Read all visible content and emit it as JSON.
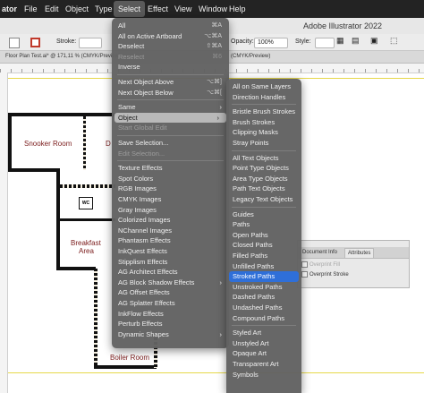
{
  "menubar": {
    "app": "ator",
    "items": [
      "File",
      "Edit",
      "Object",
      "Type",
      "Select",
      "Effect",
      "View",
      "Window",
      "Help"
    ],
    "active": "Select"
  },
  "app_title": "Adobe Illustrator 2022",
  "controlbar": {
    "stroke_label": "Stroke:",
    "opacity_label": "Opacity:",
    "opacity_value": "100%",
    "style_label": "Style:"
  },
  "document_tab": "Floor Plan Test.ai* @ 171,11 % (CMYK/Preview)",
  "document_tab_2": "(CMYK/Preview)",
  "floorplan": {
    "rooms": [
      "Snooker Room",
      "D",
      "WC",
      "Breakfast",
      "Area",
      "Boiler Room"
    ]
  },
  "select_menu": {
    "items": [
      {
        "label": "All",
        "shortcut": "⌘A"
      },
      {
        "label": "All on Active Artboard",
        "shortcut": "⌥⌘A"
      },
      {
        "label": "Deselect",
        "shortcut": "⇧⌘A"
      },
      {
        "label": "Reselect",
        "shortcut": "⌘6",
        "disabled": true
      },
      {
        "label": "Inverse"
      },
      {
        "label": "Next Object Above",
        "shortcut": "⌥⌘]"
      },
      {
        "label": "Next Object Below",
        "shortcut": "⌥⌘["
      },
      {
        "label": "Same",
        "submenu": true
      },
      {
        "label": "Object",
        "submenu": true,
        "highlighted": true
      },
      {
        "label": "Start Global Edit",
        "disabled": true
      },
      {
        "label": "Save Selection..."
      },
      {
        "label": "Edit Selection...",
        "disabled": true
      },
      {
        "label": "Texture Effects"
      },
      {
        "label": "Spot Colors"
      },
      {
        "label": "RGB Images"
      },
      {
        "label": "CMYK Images"
      },
      {
        "label": "Gray Images"
      },
      {
        "label": "Colorized Images"
      },
      {
        "label": "NChannel Images"
      },
      {
        "label": "Phantasm Effects"
      },
      {
        "label": "InkQuest Effects"
      },
      {
        "label": "Stipplism Effects"
      },
      {
        "label": "AG Architect Effects"
      },
      {
        "label": "AG Block Shadow Effects",
        "submenu": true
      },
      {
        "label": "AG Offset Effects"
      },
      {
        "label": "AG Splatter Effects"
      },
      {
        "label": "InkFlow Effects"
      },
      {
        "label": "Perturb Effects"
      },
      {
        "label": "Dynamic Shapes",
        "submenu": true
      }
    ]
  },
  "object_submenu": {
    "items": [
      {
        "label": "All on Same Layers"
      },
      {
        "label": "Direction Handles"
      },
      {
        "label": "Bristle Brush Strokes"
      },
      {
        "label": "Brush Strokes"
      },
      {
        "label": "Clipping Masks"
      },
      {
        "label": "Stray Points"
      },
      {
        "label": "All Text Objects"
      },
      {
        "label": "Point Type Objects"
      },
      {
        "label": "Area Type Objects"
      },
      {
        "label": "Path Text Objects"
      },
      {
        "label": "Legacy Text Objects"
      },
      {
        "label": "Guides"
      },
      {
        "label": "Paths"
      },
      {
        "label": "Open Paths"
      },
      {
        "label": "Closed Paths"
      },
      {
        "label": "Filled Paths"
      },
      {
        "label": "Unfilled Paths"
      },
      {
        "label": "Stroked Paths",
        "selected": true
      },
      {
        "label": "Unstroked Paths"
      },
      {
        "label": "Dashed Paths"
      },
      {
        "label": "Undashed Paths"
      },
      {
        "label": "Compound Paths"
      },
      {
        "label": "Styled Art"
      },
      {
        "label": "Unstyled Art"
      },
      {
        "label": "Opaque Art"
      },
      {
        "label": "Transparent Art"
      },
      {
        "label": "Symbols"
      }
    ]
  },
  "attributes_panel": {
    "tabs": [
      "Document Info",
      "Attributes"
    ],
    "active_tab": "Attributes",
    "overprint_fill": "Overprint Fill",
    "overprint_stroke": "Overprint Stroke"
  },
  "colors": {
    "menu_bg": "#626262",
    "selected": "#2f6fd8",
    "stroke_swatch": "#c0392b",
    "room_label": "#7a1b1b"
  }
}
